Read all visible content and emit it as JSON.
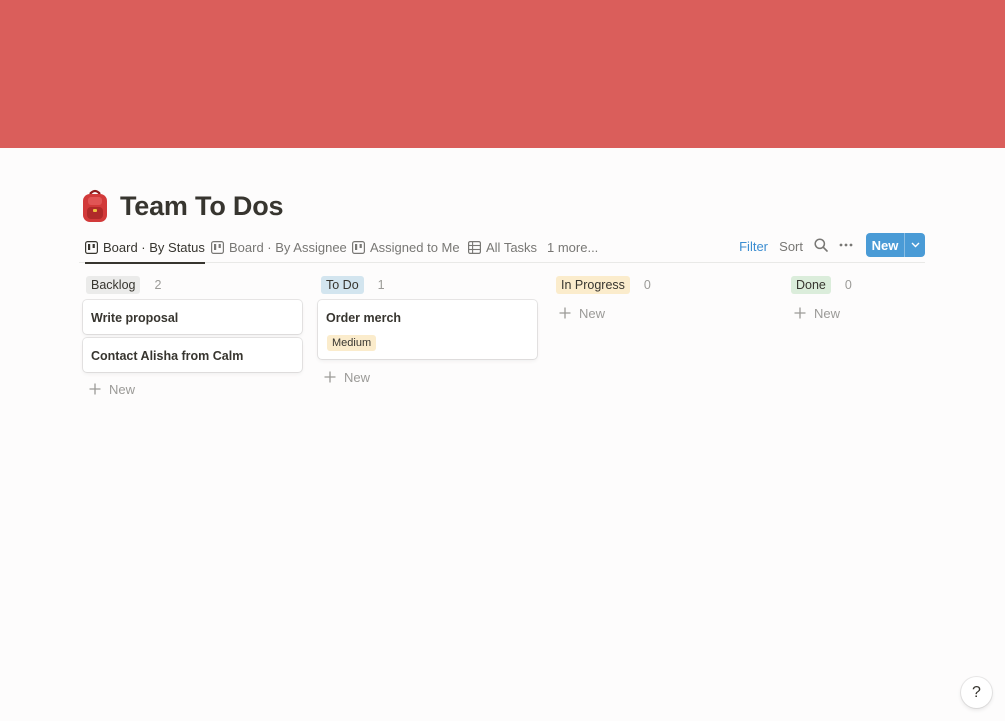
{
  "page": {
    "title": "Team To Dos",
    "emoji": "backpack-icon",
    "cover_color": "#da5e5b"
  },
  "tabs": [
    {
      "label": "Board · By Status",
      "icon": "board-icon",
      "active": true
    },
    {
      "label": "Board · By Assignee",
      "icon": "board-icon",
      "active": false
    },
    {
      "label": "Assigned to Me",
      "icon": "board-icon",
      "active": false
    },
    {
      "label": "All Tasks",
      "icon": "table-icon",
      "active": false
    },
    {
      "label": "1 more...",
      "active": false
    }
  ],
  "toolbar": {
    "filter_label": "Filter",
    "sort_label": "Sort",
    "new_label": "New",
    "accent_color": "#4a9bd6"
  },
  "columns": [
    {
      "name": "Backlog",
      "count": "2",
      "color": "#ebebea",
      "cards": [
        {
          "title": "Write proposal"
        },
        {
          "title": "Contact Alisha from Calm"
        }
      ],
      "new_label": "New"
    },
    {
      "name": "To Do",
      "count": "1",
      "color": "#d3e5ef",
      "cards": [
        {
          "title": "Order merch",
          "tag": "Medium",
          "tag_color": "#fbeccc"
        }
      ],
      "new_label": "New"
    },
    {
      "name": "In Progress",
      "count": "0",
      "color": "#fbeccc",
      "cards": [],
      "new_label": "New"
    },
    {
      "name": "Done",
      "count": "0",
      "color": "#dbeddb",
      "cards": [],
      "new_label": "New"
    }
  ],
  "help": {
    "label": "?"
  }
}
